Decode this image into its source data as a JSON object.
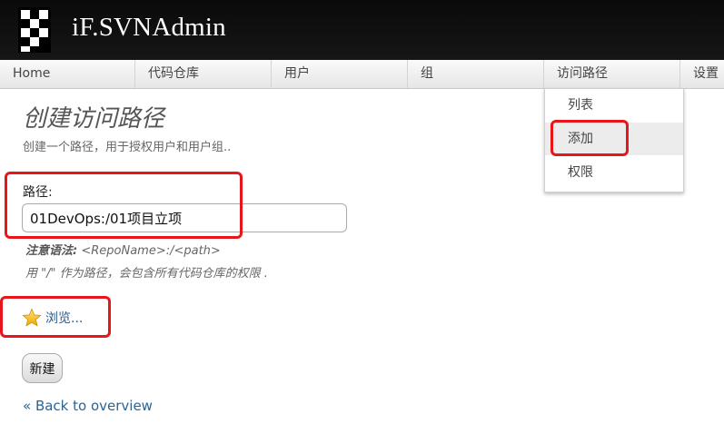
{
  "app": {
    "title": "iF.SVNAdmin"
  },
  "nav": {
    "items": [
      {
        "label": "Home"
      },
      {
        "label": "代码仓库"
      },
      {
        "label": "用户"
      },
      {
        "label": "组"
      },
      {
        "label": "访问路径"
      },
      {
        "label": "设置"
      }
    ]
  },
  "dropdown": {
    "items": [
      {
        "label": "列表"
      },
      {
        "label": "添加",
        "highlighted": true
      },
      {
        "label": "权限"
      }
    ]
  },
  "page": {
    "title": "创建访问路径",
    "description": "创建一个路径，用于授权用户和用户组.."
  },
  "form": {
    "path_label": "路径:",
    "path_value": "01DevOps:/01项目立项",
    "syntax_label": "注意语法:",
    "syntax_pattern": "<RepoName>:/<path>",
    "hint": "用 \"/\" 作为路径，会包含所有代码仓库的权限 .",
    "browse_label": "浏览...",
    "browse_icon": "star-icon",
    "submit_label": "新建"
  },
  "back_link": {
    "label": "« Back to overview"
  },
  "annotations": {
    "highlight_color": "#e8161b"
  },
  "colors": {
    "header_bg": "#0a0a0a",
    "link": "#2a6496"
  }
}
